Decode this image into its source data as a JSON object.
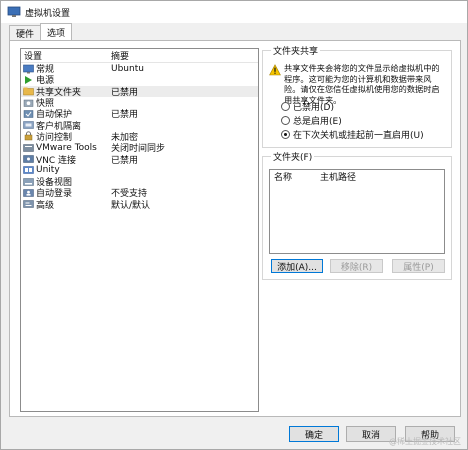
{
  "window": {
    "title": "虚拟机设置",
    "icon": "vm-settings-icon"
  },
  "tabs": [
    {
      "label": "硬件",
      "active": false
    },
    {
      "label": "选项",
      "active": true
    }
  ],
  "device_list": {
    "headers": {
      "setting": "设置",
      "summary": "摘要"
    },
    "items": [
      {
        "label": "常规",
        "summary": "Ubuntu",
        "icon": "general-icon",
        "selected": false
      },
      {
        "label": "电源",
        "summary": "",
        "icon": "power-icon",
        "selected": false
      },
      {
        "label": "共享文件夹",
        "summary": "已禁用",
        "icon": "shared-folder-icon",
        "selected": true
      },
      {
        "label": "快照",
        "summary": "",
        "icon": "snapshot-icon",
        "selected": false
      },
      {
        "label": "自动保护",
        "summary": "已禁用",
        "icon": "autoprotect-icon",
        "selected": false
      },
      {
        "label": "客户机隔离",
        "summary": "",
        "icon": "guest-isolation-icon",
        "selected": false
      },
      {
        "label": "访问控制",
        "summary": "未加密",
        "icon": "access-control-icon",
        "selected": false
      },
      {
        "label": "VMware Tools",
        "summary": "关闭时间同步",
        "icon": "vmware-tools-icon",
        "selected": false
      },
      {
        "label": "VNC 连接",
        "summary": "已禁用",
        "icon": "vnc-icon",
        "selected": false
      },
      {
        "label": "Unity",
        "summary": "",
        "icon": "unity-icon",
        "selected": false
      },
      {
        "label": "设备视图",
        "summary": "",
        "icon": "device-view-icon",
        "selected": false
      },
      {
        "label": "自动登录",
        "summary": "不受支持",
        "icon": "autologin-icon",
        "selected": false
      },
      {
        "label": "高级",
        "summary": "默认/默认",
        "icon": "advanced-icon",
        "selected": false
      }
    ]
  },
  "folder_sharing": {
    "title": "文件夹共享",
    "warning": "共享文件夹会将您的文件显示给虚拟机中的程序。这可能为您的计算机和数据带来风险。请仅在您信任虚拟机使用您的数据时启用共享文件夹。",
    "options": [
      {
        "label": "已禁用(D)",
        "checked": false
      },
      {
        "label": "总是启用(E)",
        "checked": false
      },
      {
        "label": "在下次关机或挂起前一直启用(U)",
        "checked": true
      }
    ]
  },
  "folders": {
    "title": "文件夹(F)",
    "columns": {
      "name": "名称",
      "host_path": "主机路径"
    },
    "buttons": {
      "add": "添加(A)...",
      "remove": "移除(R)",
      "properties": "属性(P)"
    }
  },
  "footer": {
    "ok": "确定",
    "cancel": "取消",
    "help": "帮助"
  },
  "watermark": "@稀土掘金技术社区",
  "colors": {
    "accent": "#0078d7",
    "warning": "#f5c400",
    "selected_row": "#ececec"
  }
}
